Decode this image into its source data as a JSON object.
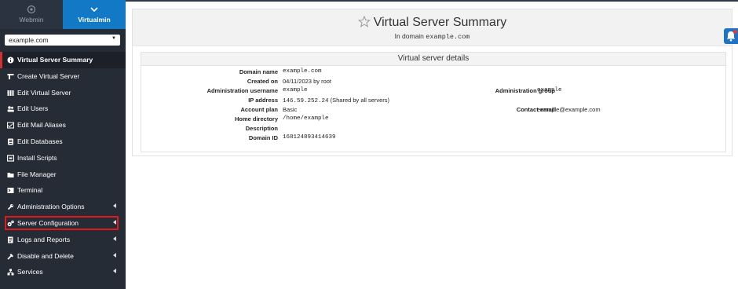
{
  "tabs": {
    "webmin": "Webmin",
    "virtualmin": "Virtualmin"
  },
  "domain_select": {
    "value": "example.com"
  },
  "menu": [
    {
      "label": "Virtual Server Summary",
      "icon": "info-icon",
      "active": true
    },
    {
      "label": "Create Virtual Server",
      "icon": "create-icon"
    },
    {
      "label": "Edit Virtual Server",
      "icon": "edit-server-icon"
    },
    {
      "label": "Edit Users",
      "icon": "users-icon"
    },
    {
      "label": "Edit Mail Aliases",
      "icon": "mail-alias-icon"
    },
    {
      "label": "Edit Databases",
      "icon": "database-icon"
    },
    {
      "label": "Install Scripts",
      "icon": "scripts-icon"
    },
    {
      "label": "File Manager",
      "icon": "folder-icon"
    },
    {
      "label": "Terminal",
      "icon": "terminal-icon"
    },
    {
      "label": "Administration Options",
      "icon": "wrench-icon",
      "submenu": true
    },
    {
      "label": "Server Configuration",
      "icon": "gears-icon",
      "submenu": true,
      "highlighted": true
    },
    {
      "label": "Logs and Reports",
      "icon": "logs-icon",
      "submenu": true
    },
    {
      "label": "Disable and Delete",
      "icon": "disable-icon",
      "submenu": true
    },
    {
      "label": "Services",
      "icon": "services-icon",
      "submenu": true
    }
  ],
  "summary": {
    "title": "Virtual Server Summary",
    "subtitle_prefix": "In domain",
    "subtitle_domain": "example.com"
  },
  "details": {
    "heading": "Virtual server details",
    "domain_name": {
      "label": "Domain name",
      "value": "example.com"
    },
    "created_on": {
      "label": "Created on",
      "value": "04/11/2023 by root"
    },
    "admin_username": {
      "label": "Administration username",
      "value": "example"
    },
    "admin_group": {
      "label": "Administration group",
      "value": "example"
    },
    "ip_address": {
      "label": "IP address",
      "value": "146.59.252.24",
      "note": "(Shared by all servers)"
    },
    "account_plan": {
      "label": "Account plan",
      "value": "Basic"
    },
    "contact_email": {
      "label": "Contact email",
      "value": "example@example.com"
    },
    "home_directory": {
      "label": "Home directory",
      "value": "/home/example"
    },
    "description": {
      "label": "Description",
      "value": ""
    },
    "domain_id": {
      "label": "Domain ID",
      "value": "168124893414639"
    }
  },
  "colors": {
    "sidebar_bg": "#262c36",
    "tab_active": "#1279c6",
    "highlight_box": "#e0191e",
    "active_marker": "#d32f2f"
  }
}
